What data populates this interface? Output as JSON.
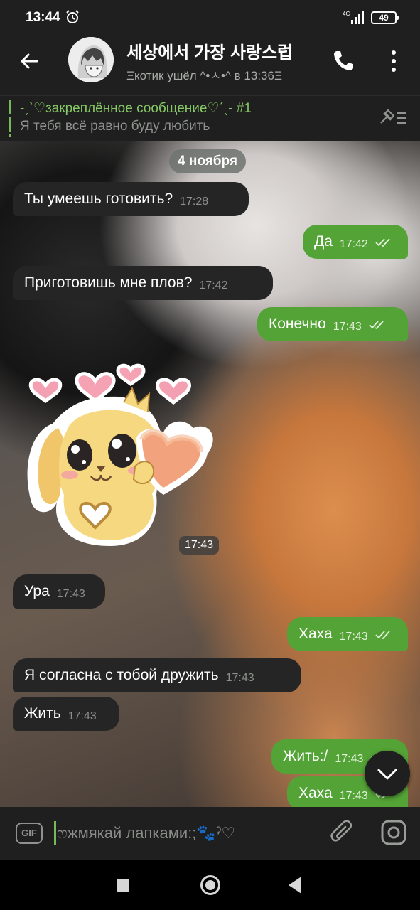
{
  "status_bar": {
    "time": "13:44",
    "network": "4G",
    "battery": "49"
  },
  "header": {
    "title": "세상에서 가장 사랑스럽",
    "status": "Ξкотик ушёл ^•ㅅ•^ в 13:36Ξ",
    "icons": [
      "arrow-left-icon",
      "phone-icon",
      "more-vertical-icon"
    ]
  },
  "pinned": {
    "title": "-ˏˋ♡закреплённое сообщение♡ˊˎ- #1",
    "text": "Я тебя всё равно буду любить"
  },
  "chat": {
    "date": "4 ноября",
    "messages": [
      {
        "dir": "in",
        "text": "Ты умеешь готовить?",
        "time": "17:28"
      },
      {
        "dir": "out",
        "text": "Да",
        "time": "17:42",
        "read": true
      },
      {
        "dir": "in",
        "text": "Приготовишь мне плов?",
        "time": "17:42"
      },
      {
        "dir": "out",
        "text": "Конечно",
        "time": "17:43",
        "read": true
      },
      {
        "dir": "in",
        "type": "sticker",
        "sticker": "puppy-with-hearts",
        "time": "17:43"
      },
      {
        "dir": "in",
        "text": "Ура",
        "time": "17:43"
      },
      {
        "dir": "out",
        "text": "Хаха",
        "time": "17:43",
        "read": true
      },
      {
        "dir": "in",
        "text": "Я согласна с тобой дружить",
        "time": "17:43"
      },
      {
        "dir": "in",
        "text": "Жить",
        "time": "17:43"
      },
      {
        "dir": "out",
        "text": "Жить:/",
        "time": "17:43",
        "read": true
      },
      {
        "dir": "out",
        "text": "Хаха",
        "time": "17:43",
        "read": true
      }
    ]
  },
  "input": {
    "placeholder": "ෆжмякай лапками:;🐾ˀ♡",
    "gif_label": "GIF"
  },
  "colors": {
    "bar_bg": "#1e1f1e",
    "outgoing_bubble": "#54a336",
    "incoming_bubble": "#242524",
    "accent_green": "#86c865"
  }
}
